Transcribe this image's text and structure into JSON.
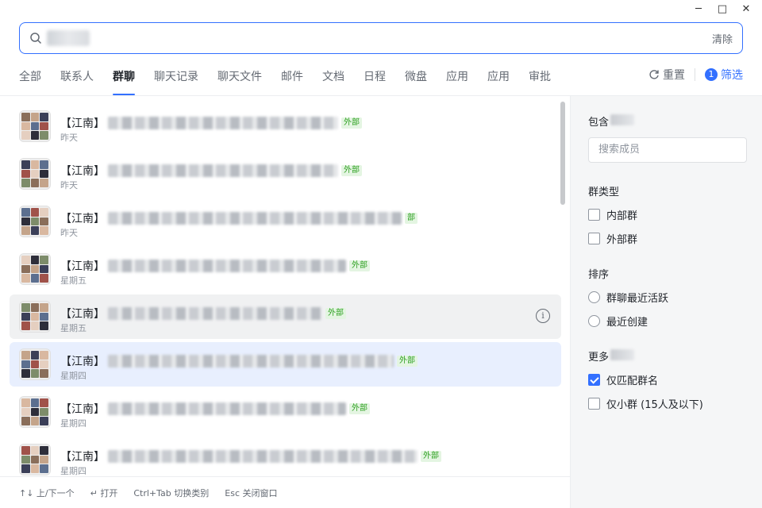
{
  "window": {
    "controls": [
      "─",
      "□",
      "✕"
    ]
  },
  "search": {
    "placeholder": "",
    "clear_label": "清除"
  },
  "tabs": [
    {
      "label": "全部",
      "active": false
    },
    {
      "label": "联系人",
      "active": false
    },
    {
      "label": "群聊",
      "active": true
    },
    {
      "label": "聊天记录",
      "active": false
    },
    {
      "label": "聊天文件",
      "active": false
    },
    {
      "label": "邮件",
      "active": false
    },
    {
      "label": "文档",
      "active": false
    },
    {
      "label": "日程",
      "active": false
    },
    {
      "label": "微盘",
      "active": false
    },
    {
      "label": "应用",
      "active": false
    },
    {
      "label": "应用",
      "active": false
    },
    {
      "label": "审批",
      "active": false
    }
  ],
  "actions": {
    "reset_label": "重置",
    "filter_label": "筛选",
    "filter_count": "1"
  },
  "results": [
    {
      "prefix": "【江南】",
      "tag": "外部",
      "time": "昨天",
      "state": "normal"
    },
    {
      "prefix": "【江南】",
      "tag": "外部",
      "time": "昨天",
      "state": "normal"
    },
    {
      "prefix": "【江南】",
      "tag": "部",
      "time": "昨天",
      "state": "normal"
    },
    {
      "prefix": "【江南】",
      "tag": "外部",
      "time": "星期五",
      "state": "normal"
    },
    {
      "prefix": "【江南】",
      "tag": "外部",
      "time": "星期五",
      "state": "hover"
    },
    {
      "prefix": "【江南】",
      "tag": "外部",
      "time": "星期四",
      "state": "selected"
    },
    {
      "prefix": "【江南】",
      "tag": "外部",
      "time": "星期四",
      "state": "normal"
    },
    {
      "prefix": "【江南】",
      "tag": "外部",
      "time": "星期四",
      "state": "normal"
    }
  ],
  "footer": {
    "navigate": "↑↓ 上/下一个",
    "open": "↵ 打开",
    "switch": "Ctrl+Tab 切换类别",
    "close": "Esc 关闭窗口"
  },
  "filters": {
    "member_section": "包含",
    "member_placeholder": "搜索成员",
    "group_type_title": "群类型",
    "group_types": [
      {
        "label": "内部群",
        "checked": false
      },
      {
        "label": "外部群",
        "checked": false
      }
    ],
    "sort_title": "排序",
    "sort_options": [
      {
        "label": "群聊最近活跃",
        "selected": false
      },
      {
        "label": "最近创建",
        "selected": false
      }
    ],
    "more_title": "更多",
    "more_options": [
      {
        "label": "仅匹配群名",
        "checked": true
      },
      {
        "label": "仅小群 (15人及以下)",
        "checked": false
      }
    ]
  },
  "colors": {
    "accent": "#3370ff",
    "external_tag_text": "#2ea121",
    "external_tag_bg": "#e4f5e2",
    "selected_row": "#e8effe",
    "hover_row": "#f0f1f2",
    "panel_bg": "#f5f6f7"
  }
}
